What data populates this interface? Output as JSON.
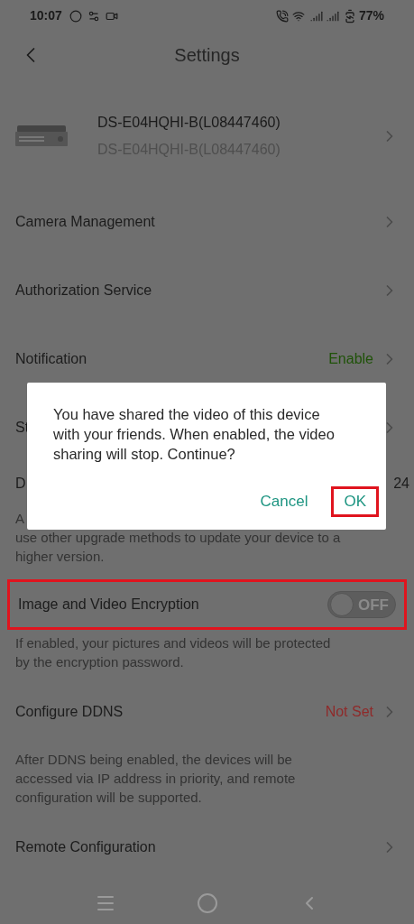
{
  "status_bar": {
    "time": "10:07",
    "battery": "77%"
  },
  "header": {
    "title": "Settings"
  },
  "device": {
    "name": "DS-E04HQHI-B(L08447460)",
    "model": "DS-E04HQHI-B(L08447460)"
  },
  "items": [
    {
      "kind": "link",
      "label": "Camera Management"
    },
    {
      "kind": "link",
      "label": "Authorization Service"
    },
    {
      "kind": "link",
      "label": "Notification",
      "value": "Enable",
      "color": "#1f5208"
    },
    {
      "kind": "covered",
      "label": "St",
      "chevron": true
    },
    {
      "kind": "covered",
      "label": "D",
      "value": "24"
    },
    {
      "kind": "note",
      "lines": [
        "A",
        "use other upgrade methods to update your device to a",
        "higher version."
      ]
    },
    {
      "kind": "toggle",
      "label": "Image and Video Encryption",
      "on": false,
      "state_text": "OFF",
      "highlighted": true
    },
    {
      "kind": "note",
      "lines": [
        "If enabled, your pictures and videos will be protected",
        "by the encryption password."
      ]
    },
    {
      "kind": "link",
      "label": "Configure DDNS",
      "value": "Not Set",
      "color": "#8f2a2a"
    },
    {
      "kind": "note",
      "lines": [
        "After DDNS being enabled, the devices will be",
        "accessed via IP address in priority, and remote",
        "configuration will be supported."
      ]
    },
    {
      "kind": "link",
      "label": "Remote Configuration"
    }
  ],
  "dialog": {
    "message": "You have shared the video of this device with your friends. When enabled, the video sharing will stop. Continue?",
    "buttons": [
      {
        "label": "Cancel",
        "highlighted": false
      },
      {
        "label": "OK",
        "highlighted": true
      }
    ]
  }
}
